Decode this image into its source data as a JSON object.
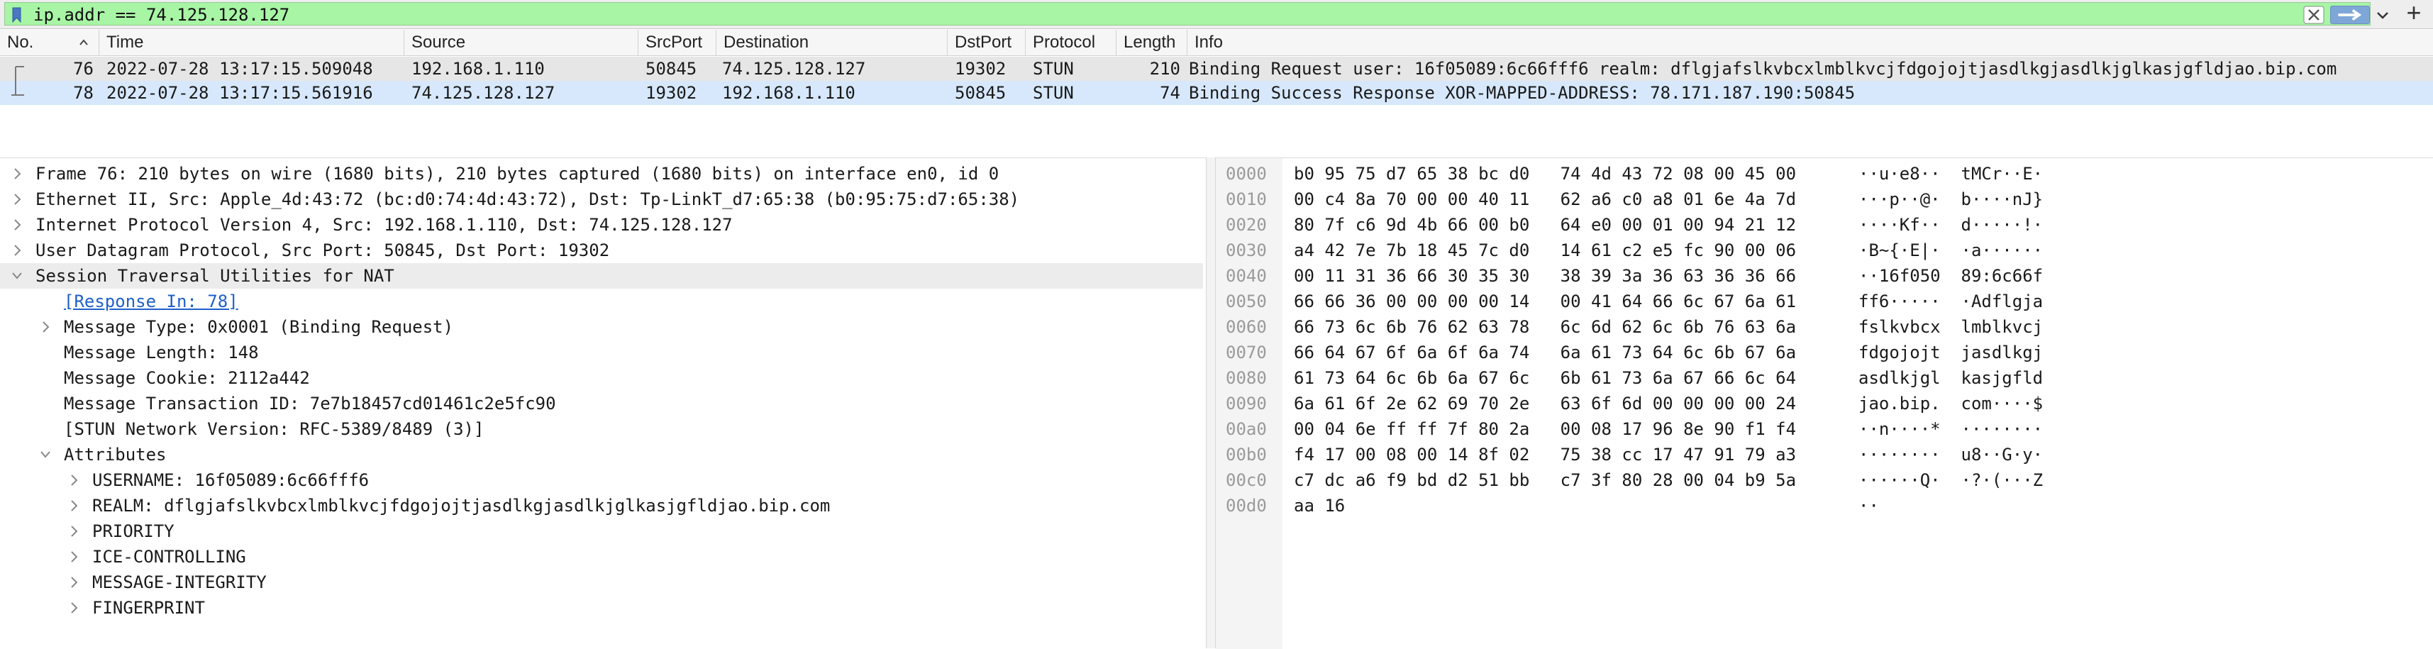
{
  "filter": {
    "value": "ip.addr == 74.125.128.127",
    "clear_icon": "clear-x-icon",
    "apply_icon": "arrow-right-icon",
    "plus": "+"
  },
  "packet_list": {
    "columns": [
      "No.",
      "Time",
      "Source",
      "SrcPort",
      "Destination",
      "DstPort",
      "Protocol",
      "Length",
      "Info"
    ],
    "rows": [
      {
        "no": "76",
        "time": "2022-07-28 13:17:15.509048",
        "source": "192.168.1.110",
        "srcport": "50845",
        "destination": "74.125.128.127",
        "dstport": "19302",
        "protocol": "STUN",
        "length": "210",
        "info": "Binding Request user: 16f05089:6c66fff6 realm: dflgjafslkvbcxlmblkvcjfdgojojtjasdlkgjasdlkjglkasjgfldjao.bip.com",
        "color": "#e6e6e6"
      },
      {
        "no": "78",
        "time": "2022-07-28 13:17:15.561916",
        "source": "74.125.128.127",
        "srcport": "19302",
        "destination": "192.168.1.110",
        "dstport": "50845",
        "protocol": "STUN",
        "length": "74",
        "info": "Binding Success Response XOR-MAPPED-ADDRESS: 78.171.187.190:50845",
        "color": "#d7e8fc"
      }
    ]
  },
  "details": [
    {
      "level": 0,
      "arrow": ">",
      "text": "Frame 76: 210 bytes on wire (1680 bits), 210 bytes captured (1680 bits) on interface en0, id 0"
    },
    {
      "level": 0,
      "arrow": ">",
      "text": "Ethernet II, Src: Apple_4d:43:72 (bc:d0:74:4d:43:72), Dst: Tp-LinkT_d7:65:38 (b0:95:75:d7:65:38)"
    },
    {
      "level": 0,
      "arrow": ">",
      "text": "Internet Protocol Version 4, Src: 192.168.1.110, Dst: 74.125.128.127"
    },
    {
      "level": 0,
      "arrow": ">",
      "text": "User Datagram Protocol, Src Port: 50845, Dst Port: 19302"
    },
    {
      "level": 0,
      "arrow": "v",
      "text": "Session Traversal Utilities for NAT"
    },
    {
      "level": 1,
      "arrow": "",
      "text": "[Response In: 78]",
      "link": true
    },
    {
      "level": 1,
      "arrow": ">",
      "text": "Message Type: 0x0001 (Binding Request)"
    },
    {
      "level": 1,
      "arrow": "",
      "text": "Message Length: 148"
    },
    {
      "level": 1,
      "arrow": "",
      "text": "Message Cookie: 2112a442"
    },
    {
      "level": 1,
      "arrow": "",
      "text": "Message Transaction ID: 7e7b18457cd01461c2e5fc90"
    },
    {
      "level": 1,
      "arrow": "",
      "text": "[STUN Network Version: RFC-5389/8489 (3)]"
    },
    {
      "level": 1,
      "arrow": "v",
      "text": "Attributes"
    },
    {
      "level": 2,
      "arrow": ">",
      "text": "USERNAME: 16f05089:6c66fff6"
    },
    {
      "level": 2,
      "arrow": ">",
      "text": "REALM: dflgjafslkvbcxlmblkvcjfdgojojtjasdlkgjasdlkjglkasjgfldjao.bip.com"
    },
    {
      "level": 2,
      "arrow": ">",
      "text": "PRIORITY"
    },
    {
      "level": 2,
      "arrow": ">",
      "text": "ICE-CONTROLLING"
    },
    {
      "level": 2,
      "arrow": ">",
      "text": "MESSAGE-INTEGRITY"
    },
    {
      "level": 2,
      "arrow": ">",
      "text": "FINGERPRINT"
    }
  ],
  "bytes": [
    {
      "offset": "0000",
      "hex": "b0 95 75 d7 65 38 bc d0   74 4d 43 72 08 00 45 00",
      "ascii": "··u·e8··  tMCr··E·"
    },
    {
      "offset": "0010",
      "hex": "00 c4 8a 70 00 00 40 11   62 a6 c0 a8 01 6e 4a 7d",
      "ascii": "···p··@·  b····nJ}"
    },
    {
      "offset": "0020",
      "hex": "80 7f c6 9d 4b 66 00 b0   64 e0 00 01 00 94 21 12",
      "ascii": "····Kf··  d·····!·"
    },
    {
      "offset": "0030",
      "hex": "a4 42 7e 7b 18 45 7c d0   14 61 c2 e5 fc 90 00 06",
      "ascii": "·B~{·E|·  ·a······"
    },
    {
      "offset": "0040",
      "hex": "00 11 31 36 66 30 35 30   38 39 3a 36 63 36 36 66",
      "ascii": "··16f050  89:6c66f"
    },
    {
      "offset": "0050",
      "hex": "66 66 36 00 00 00 00 14   00 41 64 66 6c 67 6a 61",
      "ascii": "ff6·····  ·Adflgja"
    },
    {
      "offset": "0060",
      "hex": "66 73 6c 6b 76 62 63 78   6c 6d 62 6c 6b 76 63 6a",
      "ascii": "fslkvbcx  lmblkvcj"
    },
    {
      "offset": "0070",
      "hex": "66 64 67 6f 6a 6f 6a 74   6a 61 73 64 6c 6b 67 6a",
      "ascii": "fdgojojt  jasdlkgj"
    },
    {
      "offset": "0080",
      "hex": "61 73 64 6c 6b 6a 67 6c   6b 61 73 6a 67 66 6c 64",
      "ascii": "asdlkjgl  kasjgfld"
    },
    {
      "offset": "0090",
      "hex": "6a 61 6f 2e 62 69 70 2e   63 6f 6d 00 00 00 00 24",
      "ascii": "jao.bip.  com····$"
    },
    {
      "offset": "00a0",
      "hex": "00 04 6e ff ff 7f 80 2a   00 08 17 96 8e 90 f1 f4",
      "ascii": "··n····*  ········"
    },
    {
      "offset": "00b0",
      "hex": "f4 17 00 08 00 14 8f 02   75 38 cc 17 47 91 79 a3",
      "ascii": "········  u8··G·y·"
    },
    {
      "offset": "00c0",
      "hex": "c7 dc a6 f9 bd d2 51 bb   c7 3f 80 28 00 04 b9 5a",
      "ascii": "······Q·  ·?·(···Z"
    },
    {
      "offset": "00d0",
      "hex": "aa 16",
      "ascii": "··"
    }
  ]
}
